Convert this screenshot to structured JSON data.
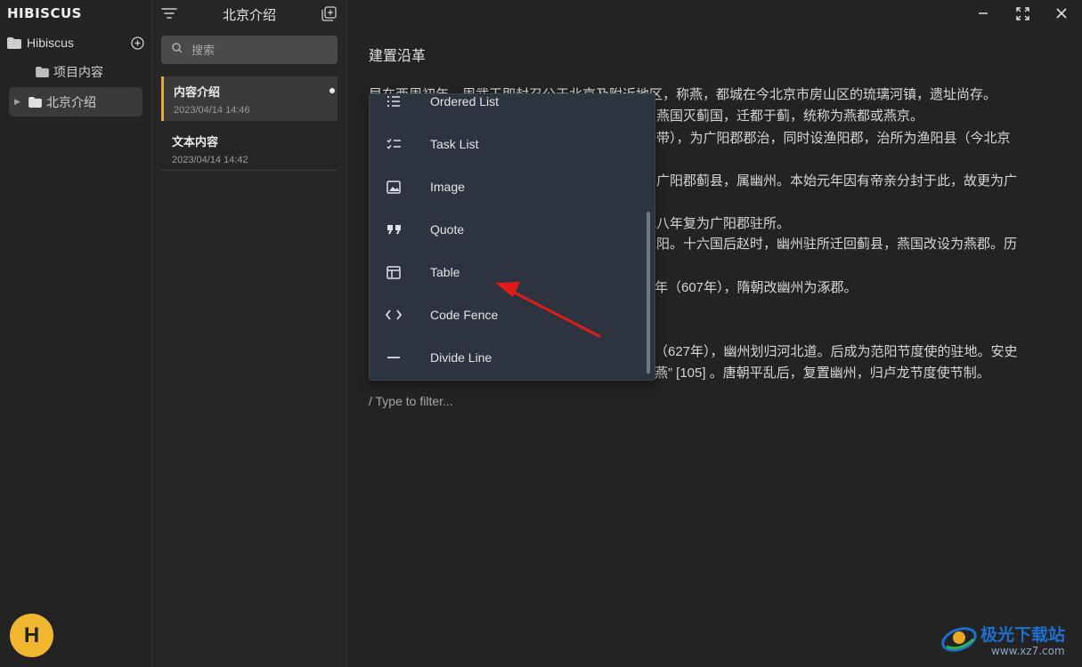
{
  "app": {
    "logo": "HIBISCUS",
    "avatar_letter": "H"
  },
  "sidebar": {
    "root_label": "Hibiscus",
    "items": [
      {
        "label": "项目内容"
      },
      {
        "label": "北京介绍"
      }
    ]
  },
  "notelist": {
    "title": "北京介绍",
    "search_placeholder": "搜索",
    "notes": [
      {
        "title": "内容介绍",
        "date": "2023/04/14 14:46"
      },
      {
        "title": "文本内容",
        "date": "2023/04/14 14:42"
      }
    ]
  },
  "editor": {
    "heading": "建置沿革",
    "lines": [
      "早在西周初年，周武王即封召公于北京及附近地区，称燕，都城在今北京市房山区的琉璃河镇，遗址尚存。",
      "燕国灭蓟国，迁都于蓟，统称为燕都或燕京。",
      "一带），为广阳郡郡治，同时设渔阳郡，治所为渔阳县（今北京",
      "为广阳郡蓟县，属幽州。本始元年因有帝亲分封于此，故更为广",
      "元八年复为广阳郡驻所。",
      "范阳。十六国后赵时，幽州驻所迁回蓟县，燕国改设为燕郡。历",
      "年（607年），隋朝改幽州为涿郡。",
      "（627年），幽州划归河北道。后成为范阳节度使的驻地。安史",
      "燕” [105] 。唐朝平乱后，复置幽州，归卢龙节度使节制。"
    ],
    "filter_hint": "/ Type to filter..."
  },
  "menu": {
    "items": [
      {
        "label": "Ordered List",
        "icon": "ordered-list-icon"
      },
      {
        "label": "Task List",
        "icon": "task-list-icon"
      },
      {
        "label": "Image",
        "icon": "image-icon"
      },
      {
        "label": "Quote",
        "icon": "quote-icon"
      },
      {
        "label": "Table",
        "icon": "table-icon"
      },
      {
        "label": "Code Fence",
        "icon": "code-icon"
      },
      {
        "label": "Divide Line",
        "icon": "divider-icon"
      }
    ]
  },
  "watermark": {
    "text": "极光下载站",
    "url": "www.xz7.com"
  },
  "colors": {
    "accent": "#e6a83a",
    "avatar": "#f1b62f",
    "arrow": "#e01b1b",
    "menu_bg": "#2d333f"
  }
}
